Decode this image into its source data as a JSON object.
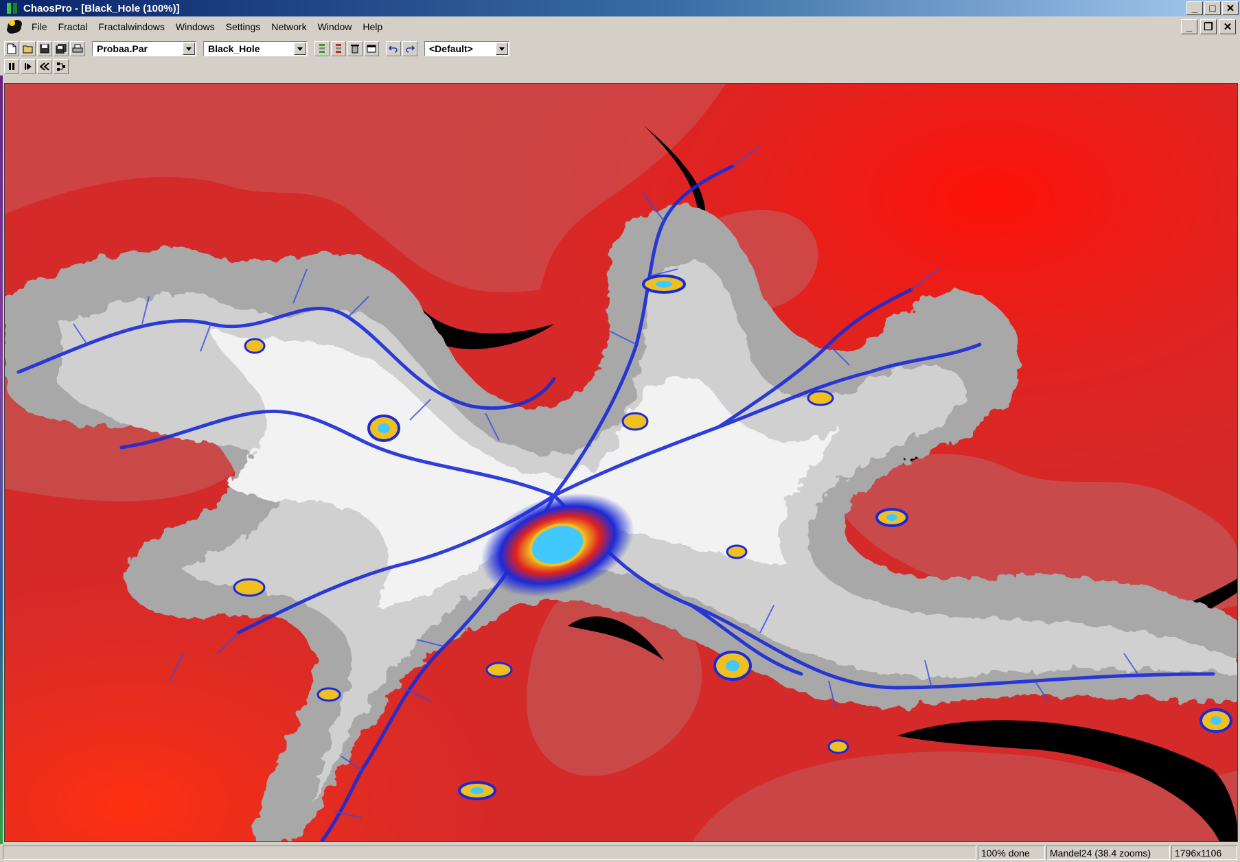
{
  "window": {
    "title": "ChaosPro - [Black_Hole (100%)]",
    "app_icon": "chaospro-icon"
  },
  "window_controls": {
    "minimize": "_",
    "maximize": "□",
    "close": "✕"
  },
  "menubar": {
    "items": [
      "File",
      "Fractal",
      "Fractalwindows",
      "Windows",
      "Settings",
      "Network",
      "Window",
      "Help"
    ]
  },
  "mdi_controls": {
    "minimize": "_",
    "restore": "❐",
    "close": "✕"
  },
  "toolbar": {
    "parameter_file": "Probaa.Par",
    "fractal_name": "Black_Hole",
    "layout": "<Default>"
  },
  "fractal": {
    "name": "Black_Hole",
    "colors": {
      "background_red": "#d42a2a",
      "bright_red": "#ff1a10",
      "gray": "#a8a8a8",
      "white": "#f4f4f4",
      "blue": "#1a2ad8",
      "gold": "#f0c020"
    }
  },
  "statusbar": {
    "progress": "100% done",
    "formula": "Mandel24 (38.4 zooms)",
    "size": "1796x1106"
  }
}
